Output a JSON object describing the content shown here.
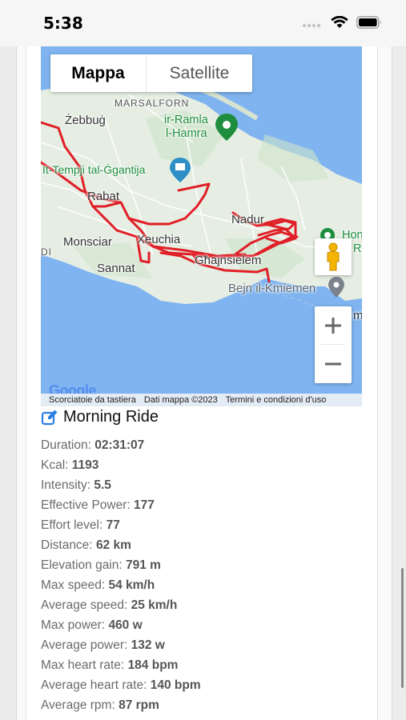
{
  "status_bar": {
    "time": "5:38"
  },
  "map": {
    "type_control": {
      "map_label": "Mappa",
      "satellite_label": "Satellite"
    },
    "places": {
      "marsalforn": "MARSALFORN",
      "zebbug": "Żebbuġ",
      "ramla": "ir-Ramla",
      "ramla2": "l-Hamra",
      "ggantija": "It-Tempji tal-Ġgantija",
      "rabat": "Rabat",
      "nadur": "Nadur",
      "monsciar": "Monsciar",
      "xeuchia": "Xeuchia",
      "ghajnsielem": "Għajnsielem",
      "sannat": "Sannat",
      "bejn": "Bejn il-Kmiemen",
      "hon": "Hon",
      "r": "R",
      "di": "DI",
      "m": "m"
    },
    "footer": {
      "shortcuts": "Scorciatoie da tastiera",
      "data": "Dati mappa ©2023",
      "terms": "Termini e condizioni d'uso"
    },
    "logo": "Google",
    "colors": {
      "route": "#e01f26",
      "water": "#7fb4f0",
      "land": "#e6eee3"
    }
  },
  "ride": {
    "title": "Morning Ride",
    "stats": [
      {
        "label": "Duration:",
        "value": "02:31:07"
      },
      {
        "label": "Kcal:",
        "value": "1193"
      },
      {
        "label": "Intensity:",
        "value": "5.5"
      },
      {
        "label": "Effective Power:",
        "value": "177"
      },
      {
        "label": "Effort level:",
        "value": "77"
      },
      {
        "label": "Distance:",
        "value": "62 km"
      },
      {
        "label": "Elevation gain:",
        "value": "791 m"
      },
      {
        "label": "Max speed:",
        "value": "54 km/h"
      },
      {
        "label": "Average speed:",
        "value": "25 km/h"
      },
      {
        "label": "Max power:",
        "value": "460 w"
      },
      {
        "label": "Average power:",
        "value": "132 w"
      },
      {
        "label": "Max heart rate:",
        "value": "184 bpm"
      },
      {
        "label": "Average heart rate:",
        "value": "140 bpm"
      },
      {
        "label": "Average rpm:",
        "value": "87 rpm"
      }
    ]
  },
  "icons": {
    "edit": "edit-icon",
    "wifi": "wifi-icon",
    "battery": "battery-icon",
    "signal": "signal-icon",
    "pegman": "pegman-icon",
    "zoom_in": "plus-icon",
    "zoom_out": "minus-icon"
  }
}
